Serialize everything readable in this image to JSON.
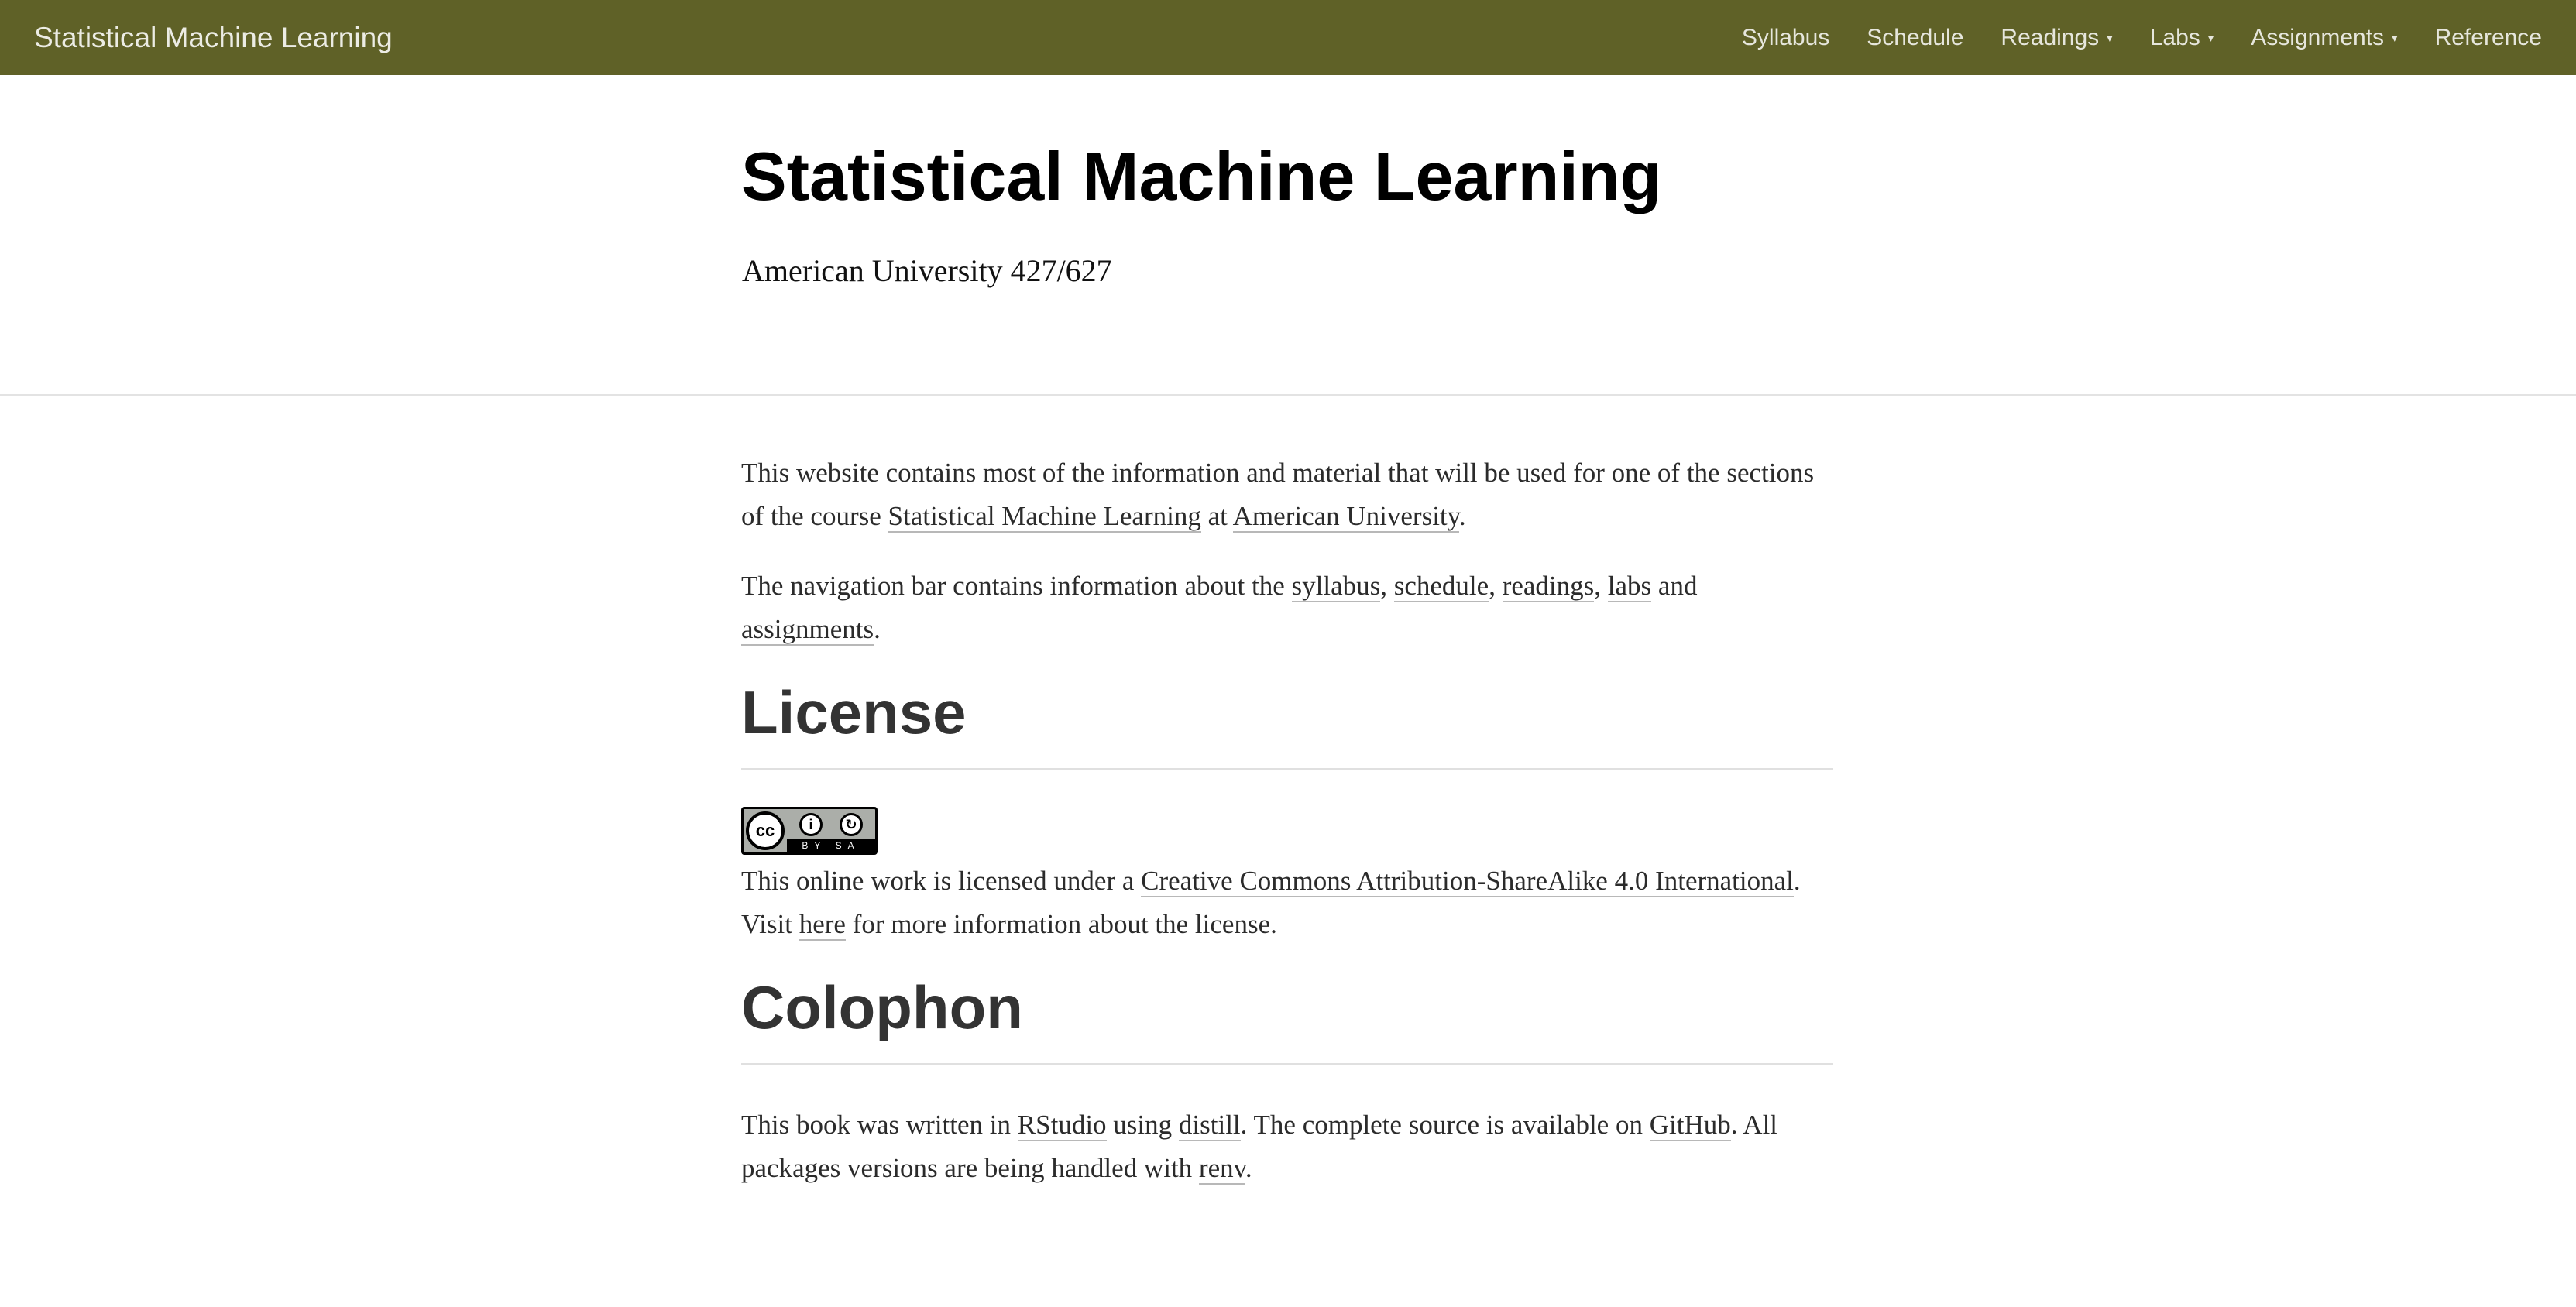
{
  "navbar": {
    "brand": "Statistical Machine Learning",
    "items": [
      {
        "label": "Syllabus",
        "dropdown": false
      },
      {
        "label": "Schedule",
        "dropdown": false
      },
      {
        "label": "Readings",
        "dropdown": true
      },
      {
        "label": "Labs",
        "dropdown": true
      },
      {
        "label": "Assignments",
        "dropdown": true
      },
      {
        "label": "Reference",
        "dropdown": false
      }
    ],
    "caret_glyph": "▾",
    "background": "#5f6127"
  },
  "header": {
    "title": "Statistical Machine Learning",
    "subtitle": "American University 427/627"
  },
  "intro": {
    "p1_before": "This website contains most of the information and material that will be used for one of the sections of the course ",
    "p1_link1": "Statistical Machine Learning",
    "p1_mid": " at ",
    "p1_link2": "American University",
    "p1_end": ".",
    "p2_before": "The navigation bar contains information about the ",
    "p2_links": [
      "syllabus",
      "schedule",
      "readings",
      "labs",
      "assignments"
    ],
    "p2_sep": ", ",
    "p2_and": " and",
    "p2_end": "."
  },
  "license": {
    "heading": "License",
    "badge": {
      "cc": "cc",
      "by": "BY",
      "sa": "SA",
      "by_symbol": "i",
      "sa_symbol": "↻"
    },
    "text_before": "This online work is licensed under a ",
    "link": "Creative Commons Attribution-ShareAlike 4.0 International",
    "text_mid": ". Visit ",
    "here_link": "here",
    "text_end": " for more information about the license."
  },
  "colophon": {
    "heading": "Colophon",
    "t1": "This book was written in ",
    "rstudio": "RStudio",
    "t2": " using ",
    "distill": "distill",
    "t3": ". The complete source is available on ",
    "github": "GitHub",
    "t4": ". All packages versions are being handled with ",
    "renv": "renv",
    "t5": "."
  }
}
